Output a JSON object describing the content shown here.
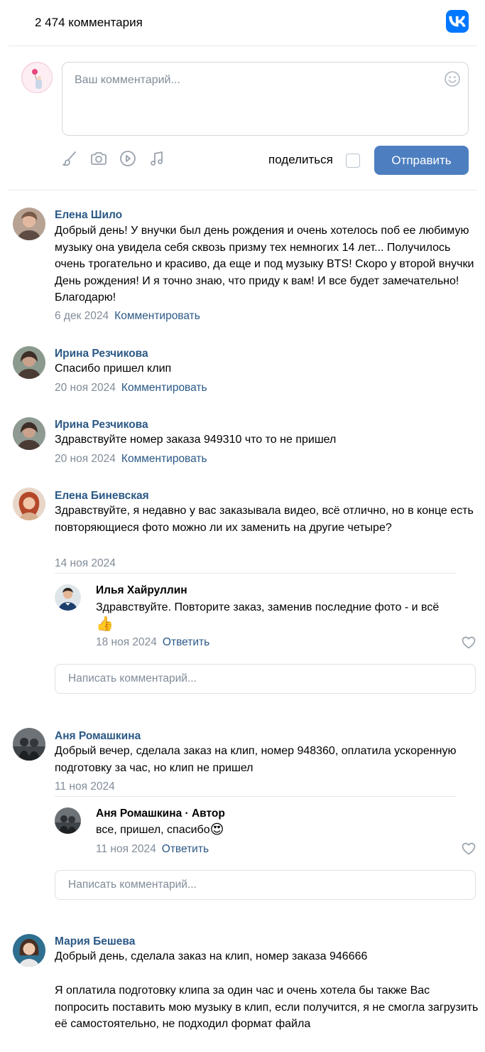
{
  "header": {
    "count_text": "2 474 комментария",
    "logo_icon": "vk-logo-icon",
    "brand_color": "#0077ff"
  },
  "composer": {
    "placeholder": "Ваш комментарий...",
    "share_label": "поделиться",
    "send_label": "Отправить",
    "share_checked": false,
    "tools": [
      "brush-icon",
      "camera-icon",
      "play-icon",
      "music-icon"
    ],
    "send_color": "#4d7fc0"
  },
  "comments": [
    {
      "author": "Елена Шило",
      "text": "Добрый день! У внучки был день рождения и очень хотелось поб ее любимую музыку она увидела себя сквозь призму тех немногих 14 лет... Получилось очень трогательно и красиво, да еще и под музыку BTS! Скоро у второй внучки День рождения! И я точно знаю, что приду к вам! И все будет замечательно! Благодарю!",
      "date": "6 дек 2024",
      "action": "Комментировать"
    },
    {
      "author": "Ирина Резчикова",
      "text": "Спасибо пришел клип",
      "date": "20 ноя 2024",
      "action": "Комментировать"
    },
    {
      "author": "Ирина Резчикова",
      "text": "Здравствуйте номер заказа 949310 что то не пришел",
      "date": "20 ноя 2024",
      "action": "Комментировать"
    },
    {
      "author": "Елена Биневская",
      "text": "Здравствуйте, я недавно у вас заказывала видео, всё отлично, но в конце есть повторяющиеся фото можно ли их заменить на другие четыре?",
      "date": "14 ноя 2024",
      "reply": {
        "author": "Илья Хайруллин",
        "text": "Здравствуйте. Повторите заказ, заменив последние фото - и всё",
        "emoji": "👍",
        "date": "18 ноя 2024",
        "action": "Ответить"
      },
      "reply_placeholder": "Написать комментарий..."
    },
    {
      "author": "Аня Ромашкина",
      "text": "Добрый вечер, сделала заказ на клип, номер 948360, оплатила ускоренную подготовку за час, но клип не пришел",
      "date": "11 ноя 2024",
      "reply": {
        "author": "Аня Ромашкина",
        "badge": " · Автор",
        "text": "все, пришел, спасибо",
        "emoji": "😍",
        "date": "11 ноя 2024",
        "action": "Ответить"
      },
      "reply_placeholder": "Написать комментарий..."
    },
    {
      "author": "Мария Бешева",
      "text": "Добрый день, сделала заказ на клип, номер заказа 946666",
      "text2": "Я оплатила подготовку клипа за один час и очень хотела бы также Вас попросить поставить мою музыку в клип, если получится, я не смогла загрузить её самостоятельно, не подходил формат файла"
    }
  ]
}
